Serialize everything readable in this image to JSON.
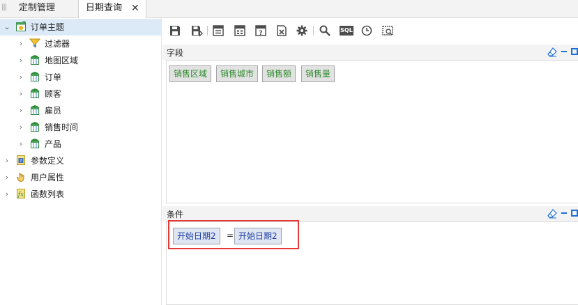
{
  "tabs": [
    {
      "label": "定制管理",
      "active": false
    },
    {
      "label": "日期查询",
      "active": true,
      "close": "✕"
    }
  ],
  "tree": {
    "root": {
      "label": "订单主题",
      "expanded": true,
      "selected": true
    },
    "children": [
      {
        "label": "过滤器",
        "icon": "filter-icon"
      },
      {
        "label": "地图区域",
        "icon": "table-icon"
      },
      {
        "label": "订单",
        "icon": "table-icon"
      },
      {
        "label": "顾客",
        "icon": "table-icon"
      },
      {
        "label": "雇员",
        "icon": "table-icon"
      },
      {
        "label": "销售时间",
        "icon": "table-icon"
      },
      {
        "label": "产品",
        "icon": "table-icon"
      }
    ],
    "others": [
      {
        "label": "参数定义",
        "icon": "parameter-icon"
      },
      {
        "label": "用户属性",
        "icon": "hand-icon"
      },
      {
        "label": "函数列表",
        "icon": "function-icon"
      }
    ]
  },
  "toolbar": {
    "icons": [
      "save-icon",
      "save-as-icon",
      "layout-icon",
      "report-icon",
      "help-icon",
      "export-icon",
      "settings-icon",
      "search-icon",
      "sql-icon",
      "clock-icon",
      "preview-icon"
    ],
    "sql_text": "SQL"
  },
  "fields_section": {
    "title": "字段",
    "chips": [
      "销售区域",
      "销售城市",
      "销售额",
      "销售量"
    ]
  },
  "conditions_section": {
    "title": "条件",
    "left_operand": "开始日期2",
    "operator": "=",
    "right_operand": "开始日期2"
  },
  "colors": {
    "accent": "#1e6fd6",
    "field_text": "#2e8b2e",
    "condition_text": "#1f3fa6",
    "highlight": "#e53935",
    "selection": "#dce9f7"
  }
}
